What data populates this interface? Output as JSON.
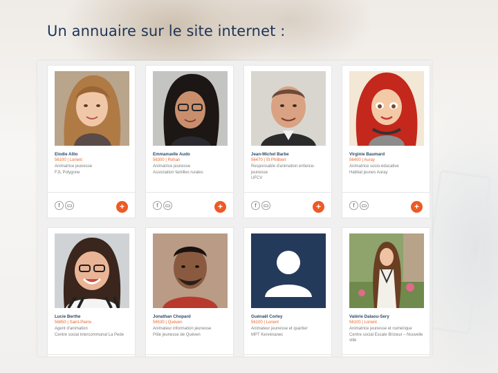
{
  "slide": {
    "title": "Un annuaire sur le site internet :"
  },
  "colors": {
    "accent": "#ee5a24",
    "name": "#2a4a68",
    "title": "#1d3557"
  },
  "profiles": [
    {
      "name": "Elodie Allio",
      "location": "56100 | Lorient",
      "role": "Animatrice jeunesse",
      "org": "FJL Polygone",
      "photo": "woman-blonde"
    },
    {
      "name": "Emmanuelle Audo",
      "location": "56300 | Rohan",
      "role": "Animatrice jeunesse",
      "org": "Association familles rurales",
      "photo": "woman-glasses"
    },
    {
      "name": "Jean-Michel Barbe",
      "location": "56470 | St Philibert",
      "role": "Responsable d'animation enfance-jeunesse",
      "org": "UFCV",
      "photo": "man-balding"
    },
    {
      "name": "Virginie Baumard",
      "location": "56400 | Auray",
      "role": "Animatrice socio-éducative",
      "org": "Habitat jeunes Auray",
      "photo": "cartoon-avatar"
    },
    {
      "name": "Lucie Berthe",
      "location": "56850 | Saint-Pierre",
      "role": "Agent d'animation",
      "org": "Centre social intercommunal La Pede",
      "photo": "woman-smiling"
    },
    {
      "name": "Jonathan Chopard",
      "location": "56530 | Quéven",
      "role": "Animateur information jeunesse",
      "org": "Pôle jeunesse de Quéven",
      "photo": "man-beard"
    },
    {
      "name": "Guénaël Corley",
      "location": "56100 | Lorient",
      "role": "Animateur jeunesse et quartier",
      "org": "MPT Kervénanec",
      "photo": "default-avatar"
    },
    {
      "name": "Valérie Dalaou-Sery",
      "location": "56100 | Lorient",
      "role": "Animatrice jeunesse et numérique",
      "org": "Centre social Escale Brizeux – Nouvelle ville",
      "photo": "woman-outdoor"
    }
  ]
}
